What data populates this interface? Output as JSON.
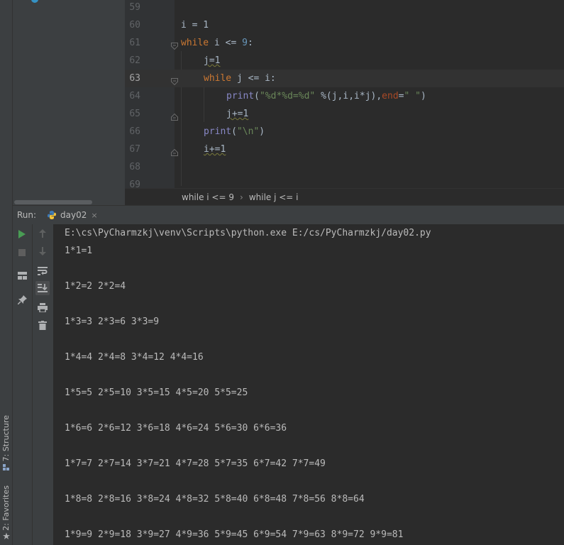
{
  "sidebar": {
    "structure_tab": "7: Structure",
    "favorites_tab": "2: Favorites"
  },
  "editor": {
    "current_line": 63,
    "lines": [
      {
        "num": "59"
      },
      {
        "num": "60"
      },
      {
        "num": "61"
      },
      {
        "num": "62"
      },
      {
        "num": "63"
      },
      {
        "num": "64"
      },
      {
        "num": "65"
      },
      {
        "num": "66"
      },
      {
        "num": "67"
      },
      {
        "num": "68"
      },
      {
        "num": "69"
      }
    ],
    "code": {
      "l60": "i = 1",
      "l61_kw": "while",
      "l61_rest": " i <= ",
      "l61_num": "9",
      "l61_end": ":",
      "l62": "j=1",
      "l63_kw": "while",
      "l63_rest": " j <= i:",
      "l64_fn": "print",
      "l64_open": "(",
      "l64_str": "\"%d*%d=%d\"",
      "l64_mid": " %(j,i,i*j),",
      "l64_param": "end",
      "l64_eq": "=",
      "l64_str2": "\" \"",
      "l64_close": ")",
      "l65": "j+=1",
      "l66_fn": "print",
      "l66_open": "(",
      "l66_str": "\"\\n\"",
      "l66_close": ")",
      "l67": "i+=1"
    }
  },
  "breadcrumb": {
    "items": [
      "while i <= 9",
      "while j <= i"
    ]
  },
  "run": {
    "title": "Run:",
    "tab_label": "day02",
    "close_glyph": "×"
  },
  "console": {
    "command": "E:\\cs\\PyCharmzkj\\venv\\Scripts\\python.exe E:/cs/PyCharmzkj/day02.py",
    "output": [
      "1*1=1",
      "",
      "1*2=2 2*2=4",
      "",
      "1*3=3 2*3=6 3*3=9",
      "",
      "1*4=4 2*4=8 3*4=12 4*4=16",
      "",
      "1*5=5 2*5=10 3*5=15 4*5=20 5*5=25",
      "",
      "1*6=6 2*6=12 3*6=18 4*6=24 5*6=30 6*6=36",
      "",
      "1*7=7 2*7=14 3*7=21 4*7=28 5*7=35 6*7=42 7*7=49",
      "",
      "1*8=8 2*8=16 3*8=24 4*8=32 5*8=40 6*8=48 7*8=56 8*8=64",
      "",
      "1*9=9 2*9=18 3*9=27 4*9=36 5*9=45 6*9=54 7*9=63 8*9=72 9*9=81"
    ]
  },
  "colors": {
    "keyword": "#cc7832",
    "number": "#6897bb",
    "string": "#6a8759",
    "builtin": "#8888c6",
    "param": "#aa4926",
    "run_green": "#499c54"
  }
}
